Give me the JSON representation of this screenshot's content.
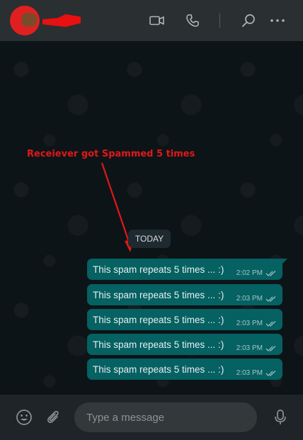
{
  "header": {
    "contact_name": "",
    "icons": [
      "video-call-icon",
      "voice-call-icon",
      "search-icon",
      "more-options-icon"
    ]
  },
  "chat": {
    "annotation": "Receiever got Spammed 5 times",
    "date_badge": "TODAY",
    "messages": [
      {
        "text": "This spam repeats 5 times ... :)",
        "time": "2:02 PM",
        "status": "read"
      },
      {
        "text": "This spam repeats 5 times ... :)",
        "time": "2:03 PM",
        "status": "read"
      },
      {
        "text": "This spam repeats 5 times ... :)",
        "time": "2:03 PM",
        "status": "read"
      },
      {
        "text": "This spam repeats 5 times ... :)",
        "time": "2:03 PM",
        "status": "read"
      },
      {
        "text": "This spam repeats 5 times ... :)",
        "time": "2:03 PM",
        "status": "read"
      }
    ]
  },
  "composer": {
    "placeholder": "Type a message",
    "icons": [
      "emoji-icon",
      "attach-icon",
      "microphone-icon"
    ]
  },
  "colors": {
    "header_bg": "#2a2f32",
    "chat_bg": "#0d1418",
    "outgoing_bubble": "#056162",
    "annotation_red": "#e01818",
    "footer_bg": "#1e2428"
  }
}
